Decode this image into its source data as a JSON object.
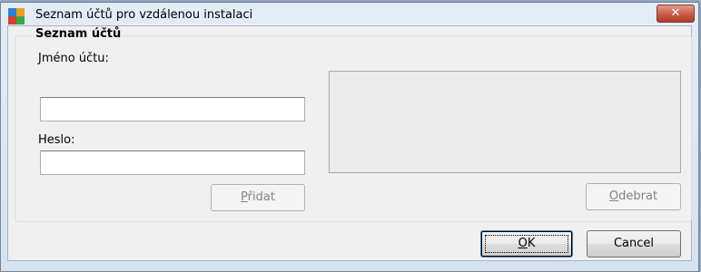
{
  "window": {
    "title": "Seznam účtů pro vzdálenou instalaci",
    "close_glyph": "✕",
    "app_icon": "avg-logo-icon"
  },
  "group": {
    "title": "Seznam účtů"
  },
  "form": {
    "account_label": "Jméno účtu:",
    "account_value": "",
    "password_label": "Heslo:",
    "password_value": ""
  },
  "buttons": {
    "add_first": "P",
    "add_rest": "řidat",
    "remove_first": "O",
    "remove_rest": "debrat",
    "ok_first": "O",
    "ok_rest": "K",
    "cancel": "Cancel"
  },
  "accounts": []
}
